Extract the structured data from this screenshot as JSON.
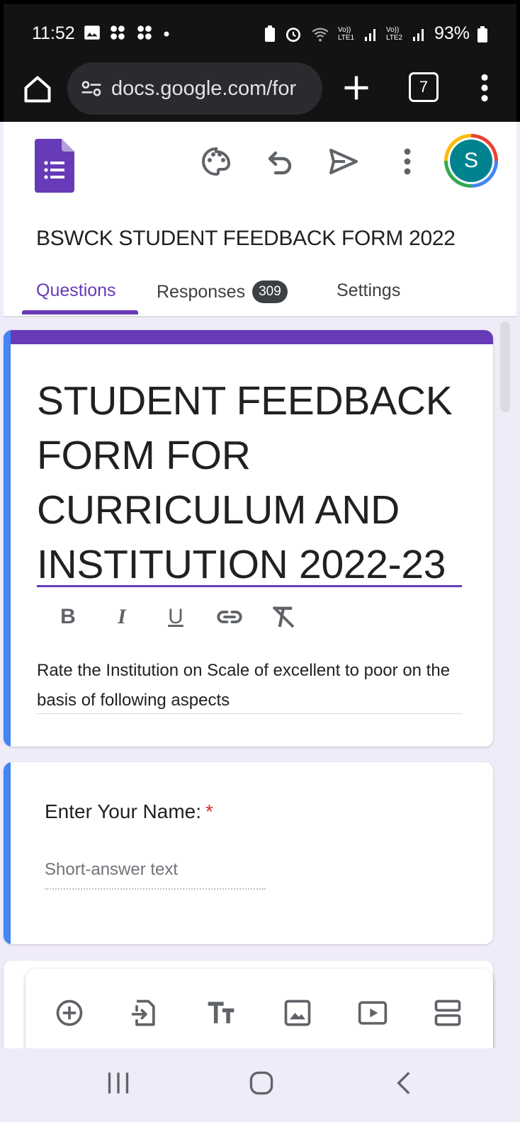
{
  "status_bar": {
    "time": "11:52",
    "battery": "93%",
    "sim1": "Vo)) LTE1",
    "sim2": "Vo)) LTE2"
  },
  "browser": {
    "url": "docs.google.com/for",
    "tab_count": "7"
  },
  "forms_header": {
    "form_name": "BSWCK STUDENT FEEDBACK FORM 2022",
    "avatar_letter": "S",
    "tabs": [
      {
        "label": "Questions",
        "active": true
      },
      {
        "label": "Responses",
        "badge": "309"
      },
      {
        "label": "Settings"
      }
    ]
  },
  "title_card": {
    "title": "STUDENT FEEDBACK FORM FOR CURRICULUM AND INSTITUTION 2022-23",
    "format_buttons": [
      "B",
      "I",
      "U",
      "link-icon",
      "clear-format-icon"
    ],
    "description": "Rate the Institution on Scale of excellent to poor on the basis of following aspects"
  },
  "question_card": {
    "title": "Enter Your Name:",
    "required_mark": "*",
    "input_placeholder": "Short-answer text"
  },
  "toolbar": {
    "icons": [
      "add-question-icon",
      "import-questions-icon",
      "add-title-icon",
      "add-image-icon",
      "add-video-icon",
      "add-section-icon"
    ]
  },
  "colors": {
    "forms_purple": "#673ab7",
    "active_blue": "#4285f4",
    "background": "#f0ebf8",
    "required_red": "#d93025"
  }
}
